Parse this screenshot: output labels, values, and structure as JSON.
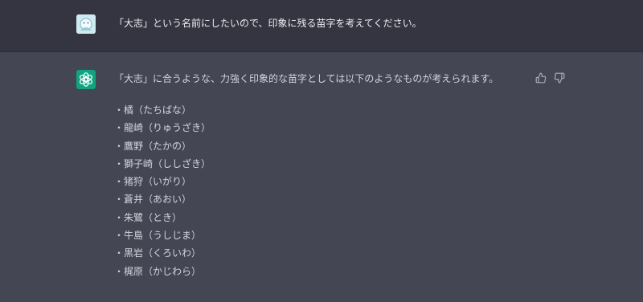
{
  "conversation": {
    "user_message": "「大志」という名前にしたいので、印象に残る苗字を考えてください。",
    "assistant_message": "「大志」に合うような、力強く印象的な苗字としては以下のようなものが考えられます。",
    "suggestions": [
      "・橘（たちばな）",
      "・龍崎（りゅうざき）",
      "・鷹野（たかの）",
      "・獅子崎（ししざき）",
      "・猪狩（いがり）",
      "・蒼井（あおい）",
      "・朱鷺（とき）",
      "・牛島（うしじま）",
      "・黒岩（くろいわ）",
      "・梶原（かじわら）"
    ]
  },
  "icons": {
    "user_avatar": "user-avatar-icon",
    "assistant_avatar": "openai-logo-icon",
    "thumbs_up": "thumbs-up-icon",
    "thumbs_down": "thumbs-down-icon"
  },
  "colors": {
    "user_row_bg": "#343541",
    "assistant_row_bg": "#444654",
    "assistant_avatar_bg": "#10a37f",
    "text": "#ececf1",
    "muted_icon": "#acacbe"
  }
}
